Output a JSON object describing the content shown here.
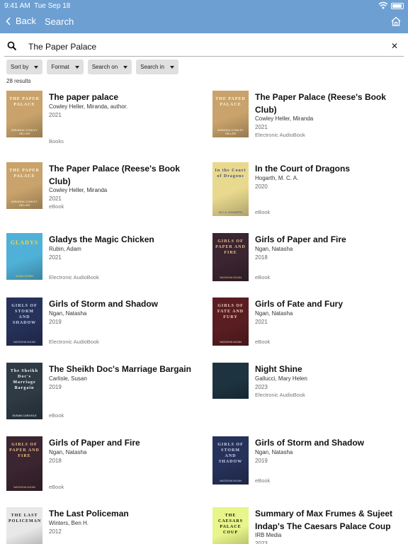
{
  "status": {
    "time": "9:41 AM",
    "date": "Tue Sep 18"
  },
  "nav": {
    "back_label": "Back",
    "title": "Search"
  },
  "search": {
    "value": "The Paper Palace"
  },
  "filters": [
    "Sort by",
    "Format",
    "Search on",
    "Search in"
  ],
  "results_count": "28 results",
  "results": [
    {
      "title": "The paper palace",
      "author": "Cowley Heller, Miranda, author.",
      "year": "2021",
      "format": "Books"
    },
    {
      "title": "The Paper Palace (Reese's Book Club)",
      "author": "Cowley Heller, Miranda",
      "year": "2021",
      "format": "Electronic AudioBook"
    },
    {
      "title": "The Paper Palace (Reese's Book Club)",
      "author": "Cowley Heller, Miranda",
      "year": "2021",
      "format": "eBook"
    },
    {
      "title": "In the Court of Dragons",
      "author": "Hogarth, M. C. A.",
      "year": "2020",
      "format": "eBook"
    },
    {
      "title": "Gladys the Magic Chicken",
      "author": "Rubin, Adam",
      "year": "2021",
      "format": "Electronic AudioBook"
    },
    {
      "title": "Girls of Paper and Fire",
      "author": "Ngan, Natasha",
      "year": "2018",
      "format": "eBook"
    },
    {
      "title": "Girls of Storm and Shadow",
      "author": "Ngan, Natasha",
      "year": "2019",
      "format": "Electronic AudioBook"
    },
    {
      "title": "Girls of Fate and Fury",
      "author": "Ngan, Natasha",
      "year": "2021",
      "format": "eBook"
    },
    {
      "title": "The Sheikh Doc's Marriage Bargain",
      "author": "Carlisle, Susan",
      "year": "2019",
      "format": "eBook"
    },
    {
      "title": "Night Shine",
      "author": "Gallucci, Mary Helen",
      "year": "2023",
      "format": "Electronic AudioBook"
    },
    {
      "title": "Girls of Paper and Fire",
      "author": "Ngan, Natasha",
      "year": "2018",
      "format": "eBook"
    },
    {
      "title": "Girls of Storm and Shadow",
      "author": "Ngan, Natasha",
      "year": "2019",
      "format": "eBook"
    },
    {
      "title": "The Last Policeman",
      "author": "Winters, Ben H.",
      "year": "2012",
      "format": ""
    },
    {
      "title": "Summary of Max Frumes & Sujeet Indap's The Caesars Palace Coup",
      "author": "IRB Media",
      "year": "2023",
      "format": ""
    }
  ],
  "covers": [
    {
      "text": "THE PAPER PALACE",
      "sub": "MIRANDA COWLEY HELLER",
      "bg": "#c9a36b",
      "fg": "#fdf6e0"
    },
    {
      "text": "THE PAPER PALACE",
      "sub": "MIRANDA COWLEY HELLER",
      "bg": "#c9a36b",
      "fg": "#fdf6e0"
    },
    {
      "text": "THE PAPER PALACE",
      "sub": "MIRANDA COWLEY HELLER",
      "bg": "#c9a36b",
      "fg": "#fdf6e0"
    },
    {
      "text": "In the Court of Dragons",
      "sub": "M.C.A. HOGARTH",
      "bg": "#e9d98e",
      "fg": "#3b4a7a"
    },
    {
      "text": "GLADYS",
      "sub": "ADAM RUBIN",
      "bg": "#4fb1d8",
      "fg": "#f7d23b"
    },
    {
      "text": "GIRLS OF PAPER AND FIRE",
      "sub": "NATASHA NGAN",
      "bg": "#3a2530",
      "fg": "#f2c28a"
    },
    {
      "text": "GIRLS OF STORM AND SHADOW",
      "sub": "NATASHA NGAN",
      "bg": "#27325a",
      "fg": "#cfd8f0"
    },
    {
      "text": "GIRLS OF FATE AND FURY",
      "sub": "NATASHA NGAN",
      "bg": "#5a1e22",
      "fg": "#f0d0c0"
    },
    {
      "text": "The Sheikh Doc's Marriage Bargain",
      "sub": "SUSAN CARLISLE",
      "bg": "#2e3a44",
      "fg": "#ffffff"
    },
    {
      "text": "",
      "sub": "",
      "bg": "#1d3340",
      "fg": "#d8e4ea"
    },
    {
      "text": "GIRLS OF PAPER AND FIRE",
      "sub": "NATASHA NGAN",
      "bg": "#3a2530",
      "fg": "#f2c28a"
    },
    {
      "text": "GIRLS OF STORM AND SHADOW",
      "sub": "NATASHA NGAN",
      "bg": "#27325a",
      "fg": "#cfd8f0"
    },
    {
      "text": "THE LAST POLICEMAN",
      "sub": "",
      "bg": "#e8e8e8",
      "fg": "#222222"
    },
    {
      "text": "THE CAESARS PALACE COUP",
      "sub": "",
      "bg": "#e8f58a",
      "fg": "#111111"
    }
  ],
  "icons": {
    "back": "chevron-left-icon",
    "home": "home-icon",
    "search": "search-icon",
    "clear": "close-icon",
    "wifi": "wifi-icon",
    "battery": "battery-icon"
  },
  "colors": {
    "nav_bar": "#6d9fd2",
    "filter_bg": "#e0e0e0"
  }
}
